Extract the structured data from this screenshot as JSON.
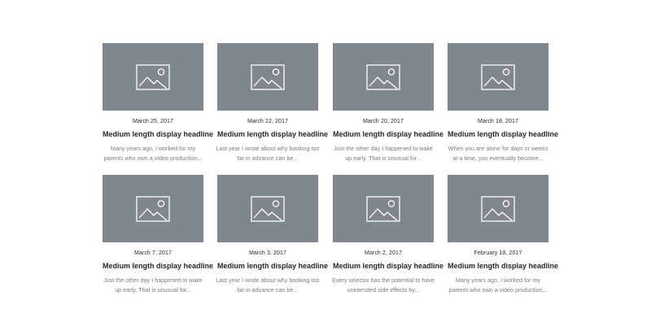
{
  "posts": [
    {
      "date": "March 25, 2017",
      "headline": "Medium length display headline",
      "excerpt": "Many years ago, I worked for my parents who own a video production...",
      "image_icon": "image-placeholder-icon"
    },
    {
      "date": "March 22, 2017",
      "headline": "Medium length display headline",
      "excerpt": "Last year I wrote about why booking too far in advance can be...",
      "image_icon": "image-placeholder-icon"
    },
    {
      "date": "March 20, 2017",
      "headline": "Medium length display headline",
      "excerpt": "Just the other day I happened to wake up early. That is unusual for...",
      "image_icon": "image-placeholder-icon"
    },
    {
      "date": "March 18, 2017",
      "headline": "Medium length display headline",
      "excerpt": "When you are alone for days or weeks at a time, you eventually become...",
      "image_icon": "image-placeholder-icon"
    },
    {
      "date": "March 7, 2017",
      "headline": "Medium length display headline",
      "excerpt": "Just the other day I happened to wake up early. That is unusual for...",
      "image_icon": "image-placeholder-icon"
    },
    {
      "date": "March 3, 2017",
      "headline": "Medium length display headline",
      "excerpt": "Last year I wrote about why booking too far in advance can be...",
      "image_icon": "image-placeholder-icon"
    },
    {
      "date": "March 2, 2017",
      "headline": "Medium length display headline",
      "excerpt": "Every selector has the potential to have unintended side effects by...",
      "image_icon": "image-placeholder-icon"
    },
    {
      "date": "February 18, 2017",
      "headline": "Medium length display headline",
      "excerpt": "Many years ago, I worked for my parents who own a video production...",
      "image_icon": "image-placeholder-icon"
    }
  ],
  "colors": {
    "placeholder_bg": "#80868e",
    "headline": "#25282b",
    "excerpt": "#777c82"
  }
}
